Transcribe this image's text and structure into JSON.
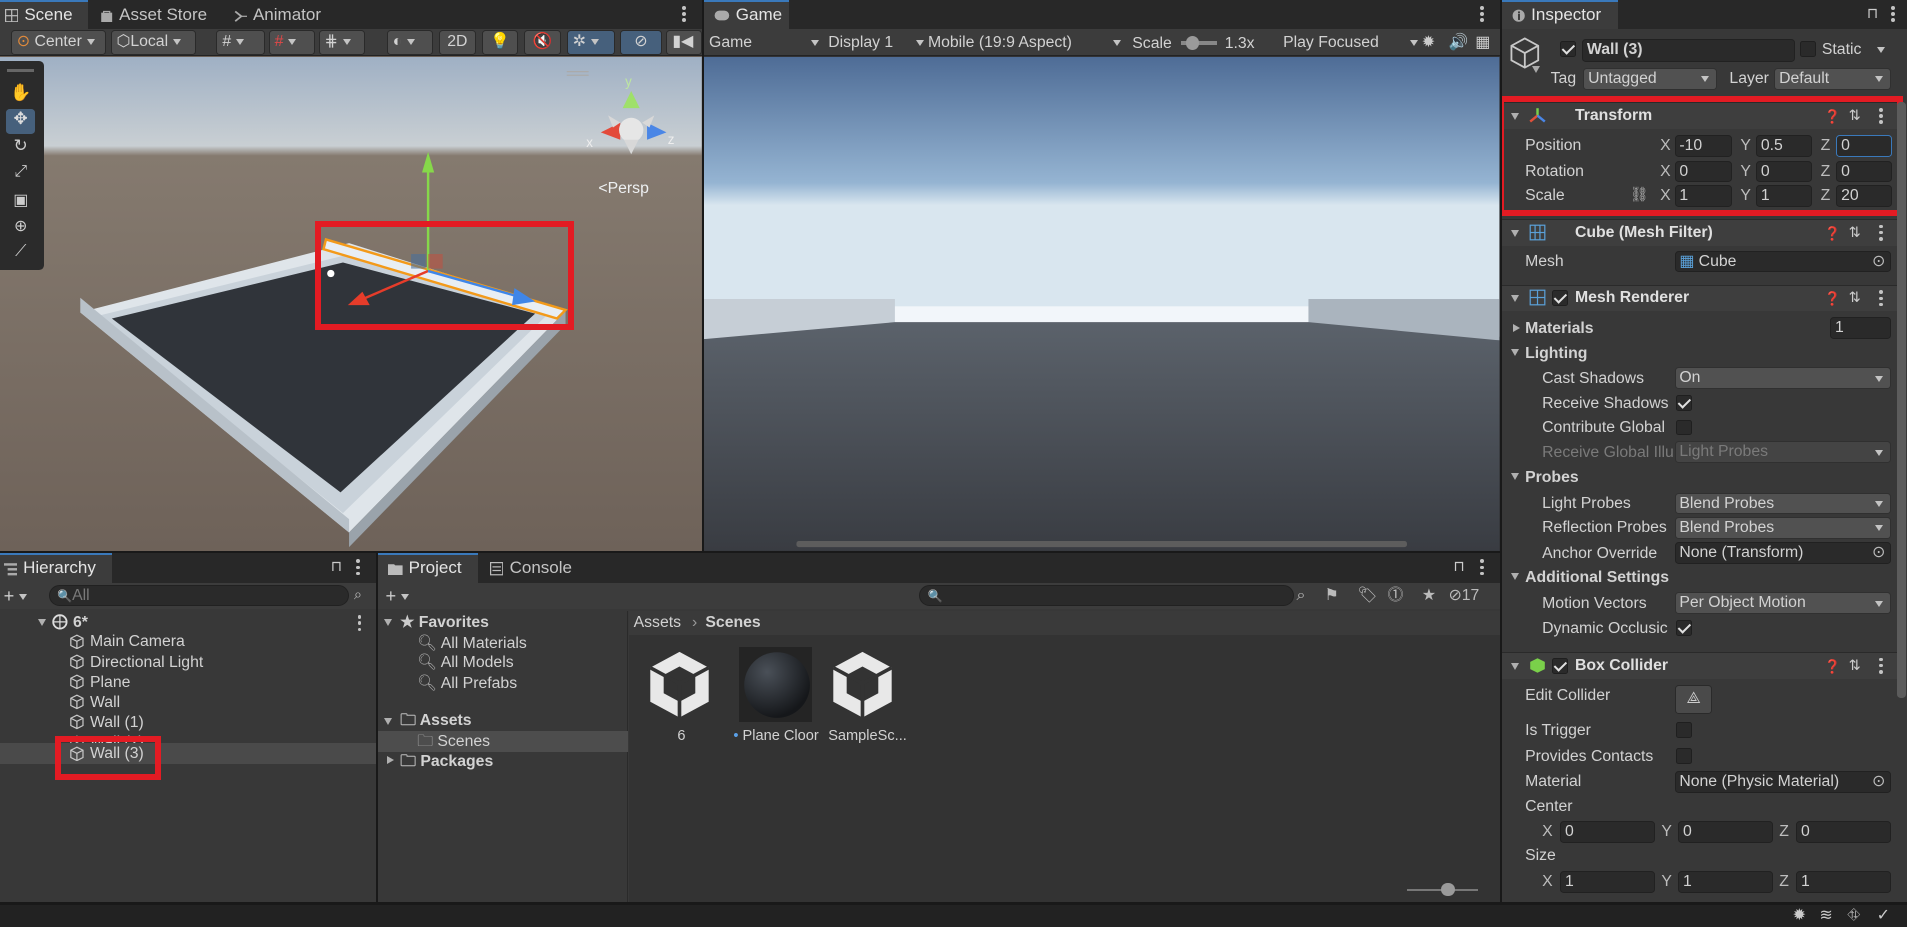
{
  "scene_panel": {
    "tabs": [
      {
        "label": "Scene"
      },
      {
        "label": "Asset Store"
      },
      {
        "label": "Animator"
      }
    ],
    "toolbar": {
      "pivot": "Center",
      "space": "Local",
      "mode_2d": "2D"
    },
    "gizmo": {
      "axis_x": "x",
      "axis_y": "y",
      "axis_z": "z",
      "persp": "Persp"
    }
  },
  "game_panel": {
    "tab": "Game",
    "toolbar": {
      "view": "Game",
      "display": "Display 1",
      "aspect": "Mobile (19:9 Aspect)",
      "scale_label": "Scale",
      "scale_value": "1.3x",
      "play_mode": "Play Focused"
    }
  },
  "inspector": {
    "tab": "Inspector",
    "object": {
      "name": "Wall (3)",
      "static_label": "Static",
      "tag_label": "Tag",
      "tag_value": "Untagged",
      "layer_label": "Layer",
      "layer_value": "Default"
    },
    "transform": {
      "title": "Transform",
      "position": {
        "label": "Position",
        "x": "-10",
        "y": "0.5",
        "z": "0"
      },
      "rotation": {
        "label": "Rotation",
        "x": "0",
        "y": "0",
        "z": "0"
      },
      "scale": {
        "label": "Scale",
        "x": "1",
        "y": "1",
        "z": "20"
      }
    },
    "axes": {
      "x": "X",
      "y": "Y",
      "z": "Z"
    },
    "mesh_filter": {
      "title": "Cube (Mesh Filter)",
      "mesh_label": "Mesh",
      "mesh_value": "Cube"
    },
    "mesh_renderer": {
      "title": "Mesh Renderer",
      "materials_label": "Materials",
      "materials_count": "1",
      "lighting_label": "Lighting",
      "cast_shadows_label": "Cast Shadows",
      "cast_shadows_value": "On",
      "receive_shadows_label": "Receive Shadows",
      "contribute_global_label": "Contribute Global",
      "receive_global_label": "Receive Global Illu",
      "receive_global_value": "Light Probes",
      "probes_label": "Probes",
      "light_probes_label": "Light Probes",
      "light_probes_value": "Blend Probes",
      "reflection_probes_label": "Reflection Probes",
      "reflection_probes_value": "Blend Probes",
      "anchor_label": "Anchor Override",
      "anchor_value": "None (Transform)",
      "additional_label": "Additional Settings",
      "motion_label": "Motion Vectors",
      "motion_value": "Per Object Motion",
      "dynamic_label": "Dynamic Occlusic"
    },
    "box_collider": {
      "title": "Box Collider",
      "edit_label": "Edit Collider",
      "trigger_label": "Is Trigger",
      "contacts_label": "Provides Contacts",
      "material_label": "Material",
      "material_value": "None (Physic Material)",
      "center_label": "Center",
      "center": {
        "x": "0",
        "y": "0",
        "z": "0"
      },
      "size_label": "Size",
      "size": {
        "x": "1",
        "y": "1",
        "z": "1"
      }
    }
  },
  "hierarchy": {
    "tab": "Hierarchy",
    "search_placeholder": "All",
    "scene_name": "6*",
    "items": [
      {
        "label": "Main Camera"
      },
      {
        "label": "Directional Light"
      },
      {
        "label": "Plane"
      },
      {
        "label": "Wall"
      },
      {
        "label": "Wall (1)"
      },
      {
        "label": "Wall (2)"
      },
      {
        "label": "Wall (3)"
      }
    ]
  },
  "project": {
    "tabs": [
      {
        "label": "Project"
      },
      {
        "label": "Console"
      }
    ],
    "hidden_count": "17",
    "favorites_label": "Favorites",
    "favorites": [
      {
        "label": "All Materials"
      },
      {
        "label": "All Models"
      },
      {
        "label": "All Prefabs"
      }
    ],
    "assets_label": "Assets",
    "scenes_label": "Scenes",
    "packages_label": "Packages",
    "breadcrumb": {
      "root": "Assets",
      "current": "Scenes"
    },
    "files": [
      {
        "label": "6"
      },
      {
        "label": "Plane Cloor"
      },
      {
        "label": "SampleSc..."
      }
    ]
  }
}
